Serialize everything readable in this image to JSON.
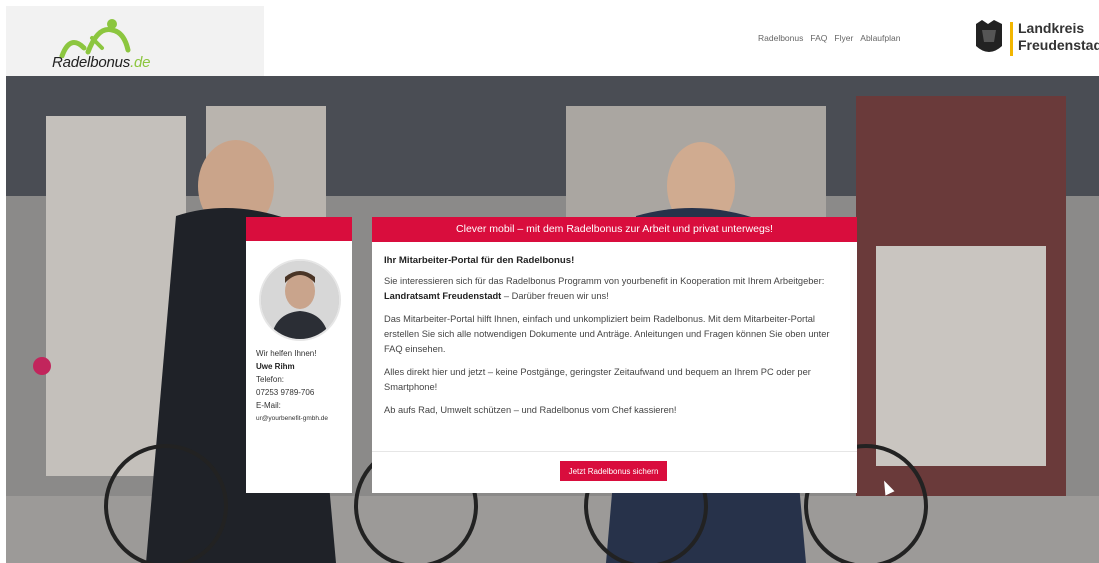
{
  "header": {
    "logo": {
      "name": "Radelbonus",
      "tld": ".de"
    },
    "nav": [
      "Radelbonus",
      "FAQ",
      "Flyer",
      "Ablaufplan"
    ],
    "landkreis": {
      "line1": "Landkreis",
      "line2": "Freudenstadt"
    }
  },
  "contact": {
    "intro": "Wir helfen Ihnen!",
    "name": "Uwe Rihm",
    "phone_label": "Telefon:",
    "phone": "07253 9789-706",
    "email_label": "E-Mail:",
    "email": "ur@yourbenefit-gmbh.de"
  },
  "main": {
    "banner": "Clever mobil – mit dem Radelbonus zur Arbeit und privat unterwegs!",
    "heading": "Ihr Mitarbeiter-Portal für den Radelbonus!",
    "p1_pre": "Sie interessieren sich für das Radelbonus Programm von yourbenefit in Kooperation mit Ihrem Arbeitgeber: ",
    "p1_employer": "Landratsamt Freudenstadt",
    "p1_post": " – Darüber freuen wir uns!",
    "p2": "Das Mitarbeiter-Portal hilft Ihnen, einfach und unkompliziert beim Radelbonus. Mit dem Mitarbeiter-Portal erstellen Sie sich alle notwendigen Dokumente und Anträge. Anleitungen und Fragen können Sie oben unter FAQ einsehen.",
    "p3": "Alles direkt hier und jetzt – keine Postgänge, geringster Zeitaufwand und bequem an Ihrem PC oder per Smartphone!",
    "p4": "Ab aufs Rad, Umwelt schützen – und Radelbonus vom Chef kassieren!",
    "cta": "Jetzt Radelbonus sichern"
  },
  "colors": {
    "accent": "#d90d3d",
    "logo_green": "#8cc63f",
    "landkreis_bar": "#f2b600"
  }
}
